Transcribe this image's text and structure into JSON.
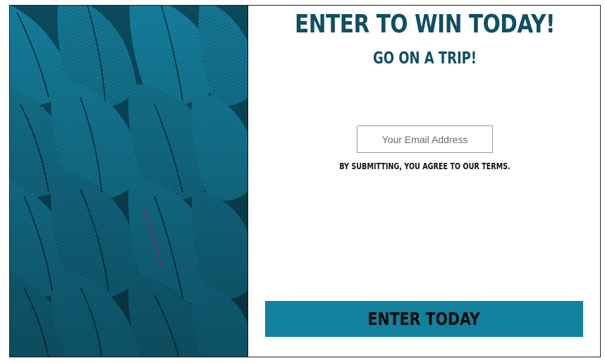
{
  "popup": {
    "headline": "ENTER TO WIN TODAY!",
    "subheadline": "GO ON A TRIP!",
    "email": {
      "placeholder": "Your Email Address",
      "value": ""
    },
    "terms": "BY SUBMITTING, YOU AGREE TO OUR TERMS.",
    "button_label": "ENTER TODAY",
    "image": {
      "description_icon": "blue-feathers-image"
    },
    "colors": {
      "headline": "#0e4f63",
      "button": "#12819e",
      "feather_dark": "#0b4b5f",
      "feather_light": "#2ab3d6"
    }
  }
}
